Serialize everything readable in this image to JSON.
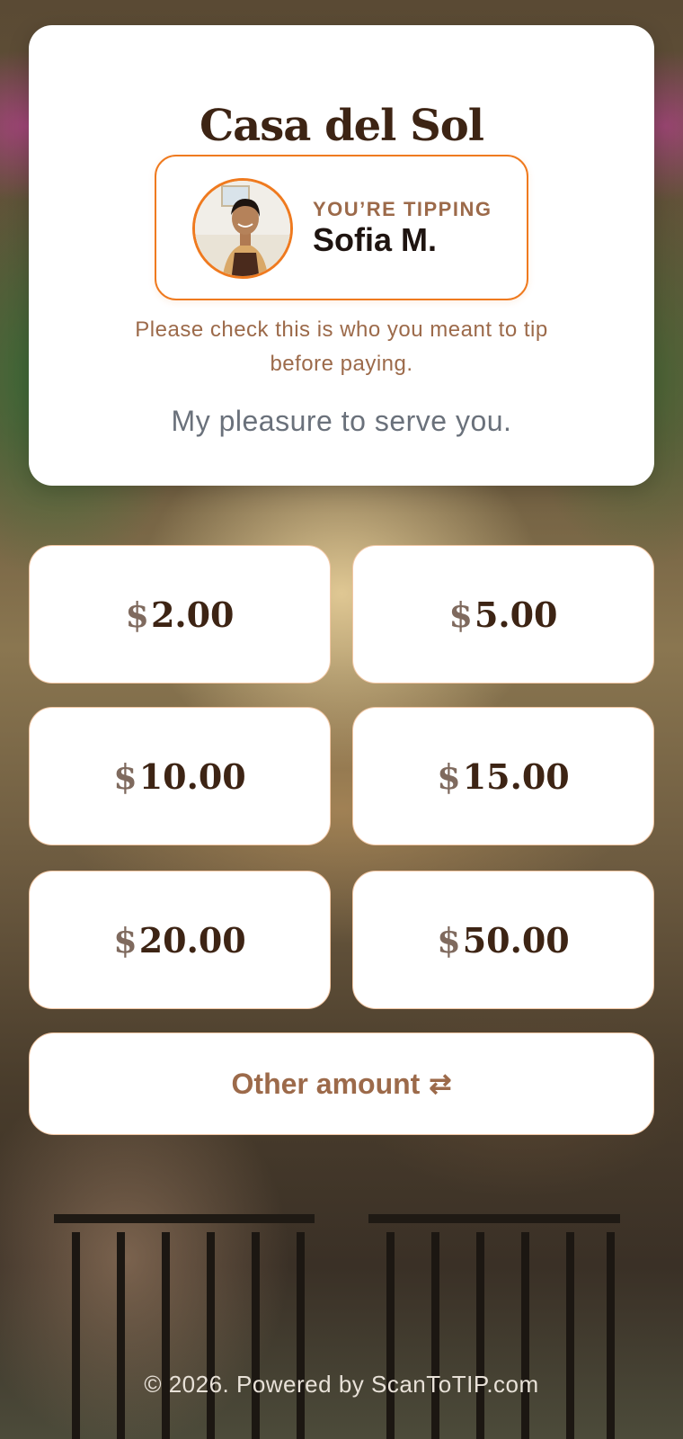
{
  "restaurant": {
    "name": "Casa del Sol"
  },
  "tipping": {
    "label": "YOU’RE TIPPING",
    "staff_name": "Sofia M.",
    "check_note": "Please check this is who you meant to tip before paying.",
    "message": "My pleasure to serve you."
  },
  "amounts": [
    {
      "currency": "$",
      "value": "2.00"
    },
    {
      "currency": "$",
      "value": "5.00"
    },
    {
      "currency": "$",
      "value": "10.00"
    },
    {
      "currency": "$",
      "value": "15.00"
    },
    {
      "currency": "$",
      "value": "20.00"
    },
    {
      "currency": "$",
      "value": "50.00"
    }
  ],
  "other": {
    "label": "Other amount",
    "icon": "⇄"
  },
  "footer": {
    "text": "© 2026. Powered by ScanToTIP.com"
  },
  "colors": {
    "accent": "#ef7a1f",
    "brown": "#3d2414",
    "muted_brown": "#9c6a4a"
  }
}
